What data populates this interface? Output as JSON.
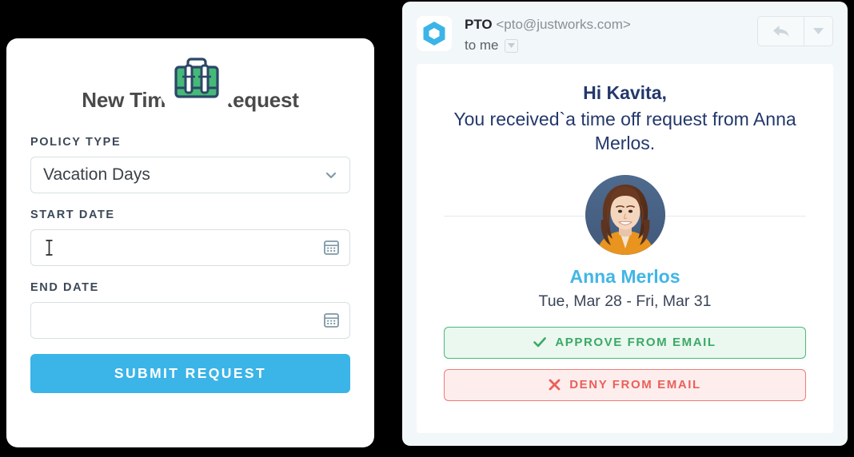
{
  "request_form": {
    "icon": "suitcase-icon",
    "title": "New Time Off Request",
    "policy_type": {
      "label": "POLICY TYPE",
      "value": "Vacation Days",
      "icon": "chevron-down-icon"
    },
    "start_date": {
      "label": "START DATE",
      "value": "",
      "placeholder": "",
      "icon": "calendar-icon",
      "cursor": "text-caret"
    },
    "end_date": {
      "label": "END DATE",
      "value": "",
      "placeholder": "",
      "icon": "calendar-icon"
    },
    "submit_label": "SUBMIT REQUEST"
  },
  "email": {
    "header": {
      "avatar_icon": "hexagon-logo-icon",
      "sender_name": "PTO",
      "sender_address": "<pto@justworks.com>",
      "recipient": "to me",
      "recipient_caret_icon": "caret-down-icon",
      "reply_icon": "reply-arrow-icon",
      "more_icon": "caret-down-icon"
    },
    "body": {
      "greeting": "Hi Kavita,",
      "message": "You received`a time off request from Anna Merlos.",
      "requester_photo": "avatar-photo",
      "requester_name": "Anna Merlos",
      "date_range": "Tue, Mar 28 - Fri, Mar 31",
      "approve_label": "APPROVE FROM EMAIL",
      "approve_icon": "check-icon",
      "deny_label": "DENY FROM EMAIL",
      "deny_icon": "x-icon"
    }
  },
  "colors": {
    "accent_blue": "#3bb4e8",
    "name_blue": "#41b6e6",
    "navy_text": "#23386b",
    "approve_green": "#3ba966",
    "deny_red": "#eb5f5a",
    "suitcase_green": "#45b978",
    "suitcase_outline": "#2c4767",
    "panel_bg": "#f2f7fa"
  }
}
